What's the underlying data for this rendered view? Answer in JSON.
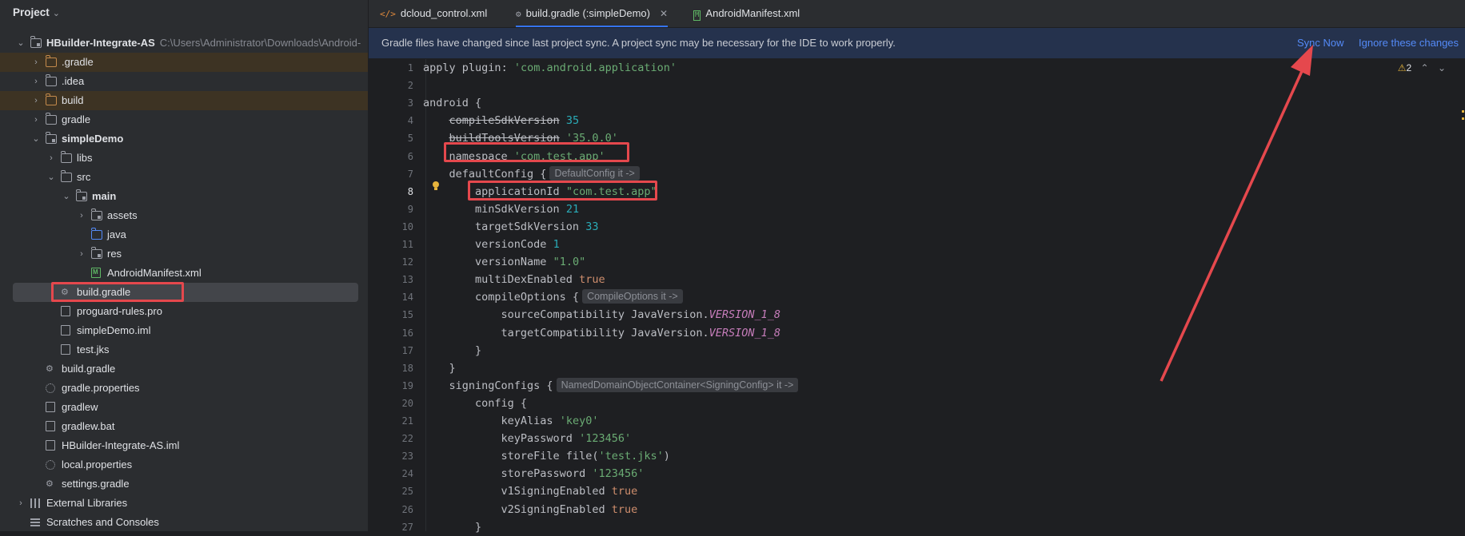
{
  "project": {
    "title": "Project",
    "tree": [
      {
        "label": "HBuilder-Integrate-AS",
        "path": "C:\\Users\\Administrator\\Downloads\\Android-",
        "depth": 0,
        "icon": "module-folder-icon",
        "expand": "down",
        "bold": true
      },
      {
        "label": ".gradle",
        "depth": 1,
        "icon": "folder-orange-icon",
        "expand": "right",
        "hl": true
      },
      {
        "label": ".idea",
        "depth": 1,
        "icon": "folder-icon",
        "expand": "right"
      },
      {
        "label": "build",
        "depth": 1,
        "icon": "folder-orange-icon",
        "expand": "right",
        "hl": true
      },
      {
        "label": "gradle",
        "depth": 1,
        "icon": "folder-icon",
        "expand": "right"
      },
      {
        "label": "simpleDemo",
        "depth": 1,
        "icon": "module-folder-icon",
        "expand": "down",
        "bold": true
      },
      {
        "label": "libs",
        "depth": 2,
        "icon": "folder-icon",
        "expand": "right"
      },
      {
        "label": "src",
        "depth": 2,
        "icon": "folder-icon",
        "expand": "down"
      },
      {
        "label": "main",
        "depth": 3,
        "icon": "module-folder-icon",
        "expand": "down",
        "bold": true
      },
      {
        "label": "assets",
        "depth": 4,
        "icon": "module-folder-icon",
        "expand": "right"
      },
      {
        "label": "java",
        "depth": 4,
        "icon": "folder-blue-icon",
        "expand": ""
      },
      {
        "label": "res",
        "depth": 4,
        "icon": "module-folder-icon",
        "expand": "right"
      },
      {
        "label": "AndroidManifest.xml",
        "depth": 4,
        "icon": "manifest-file-icon",
        "expand": ""
      },
      {
        "label": "build.gradle",
        "depth": 2,
        "icon": "gradle-icon",
        "expand": "",
        "selected": true
      },
      {
        "label": "proguard-rules.pro",
        "depth": 2,
        "icon": "file-icon",
        "expand": ""
      },
      {
        "label": "simpleDemo.iml",
        "depth": 2,
        "icon": "file-icon",
        "expand": ""
      },
      {
        "label": "test.jks",
        "depth": 2,
        "icon": "file-icon",
        "expand": ""
      },
      {
        "label": "build.gradle",
        "depth": 1,
        "icon": "gradle-icon",
        "expand": ""
      },
      {
        "label": "gradle.properties",
        "depth": 1,
        "icon": "gear-icon",
        "expand": ""
      },
      {
        "label": "gradlew",
        "depth": 1,
        "icon": "file-icon",
        "expand": ""
      },
      {
        "label": "gradlew.bat",
        "depth": 1,
        "icon": "file-icon",
        "expand": ""
      },
      {
        "label": "HBuilder-Integrate-AS.iml",
        "depth": 1,
        "icon": "file-icon",
        "expand": ""
      },
      {
        "label": "local.properties",
        "depth": 1,
        "icon": "gear-icon",
        "expand": ""
      },
      {
        "label": "settings.gradle",
        "depth": 1,
        "icon": "gradle-icon",
        "expand": ""
      },
      {
        "label": "External Libraries",
        "depth": 0,
        "icon": "library-icon",
        "expand": "right"
      },
      {
        "label": "Scratches and Consoles",
        "depth": 0,
        "icon": "scratch-icon",
        "expand": ""
      }
    ]
  },
  "tabs": [
    {
      "label": "dcloud_control.xml",
      "icon": "</>",
      "kind": "xml",
      "active": false
    },
    {
      "label": "build.gradle (:simpleDemo)",
      "icon": "⚙",
      "kind": "grd",
      "active": true,
      "close": "✕"
    },
    {
      "label": "AndroidManifest.xml",
      "icon": "M",
      "kind": "man",
      "active": false
    }
  ],
  "banner": {
    "message": "Gradle files have changed since last project sync. A project sync may be necessary for the IDE to work properly.",
    "sync_now": "Sync Now",
    "ignore": "Ignore these changes"
  },
  "editor": {
    "current_line": 8,
    "warnings": "2",
    "lines": [
      [
        [
          "apply ",
          ""
        ],
        [
          "plugin",
          ""
        ],
        [
          ": ",
          ""
        ],
        [
          "'com.android.application'",
          "str"
        ]
      ],
      [],
      [
        [
          "android {",
          ""
        ]
      ],
      [
        [
          "    ",
          ""
        ],
        [
          "compileSdkVersion",
          "strike"
        ],
        [
          " ",
          ""
        ],
        [
          "35",
          "num"
        ]
      ],
      [
        [
          "    ",
          ""
        ],
        [
          "buildToolsVersion",
          "strike"
        ],
        [
          " ",
          ""
        ],
        [
          "'35.0.0'",
          "str"
        ]
      ],
      [
        [
          "    namespace ",
          ""
        ],
        [
          "'com.test.app'",
          "str"
        ]
      ],
      [
        [
          "    defaultConfig {",
          ""
        ],
        [
          "DefaultConfig it ->",
          "hint"
        ]
      ],
      [
        [
          "        applicationId ",
          ""
        ],
        [
          "\"com.test.app\"",
          "str"
        ]
      ],
      [
        [
          "        minSdkVersion ",
          ""
        ],
        [
          "21",
          "num"
        ]
      ],
      [
        [
          "        targetSdkVersion ",
          ""
        ],
        [
          "33",
          "num"
        ]
      ],
      [
        [
          "        versionCode ",
          ""
        ],
        [
          "1",
          "num"
        ]
      ],
      [
        [
          "        versionName ",
          ""
        ],
        [
          "\"1.0\"",
          "str"
        ]
      ],
      [
        [
          "        multiDexEnabled ",
          ""
        ],
        [
          "true",
          "bool"
        ]
      ],
      [
        [
          "        compileOptions {",
          ""
        ],
        [
          "CompileOptions it ->",
          "hint"
        ]
      ],
      [
        [
          "            sourceCompatibility JavaVersion.",
          ""
        ],
        [
          "VERSION_1_8",
          "const"
        ]
      ],
      [
        [
          "            targetCompatibility JavaVersion.",
          ""
        ],
        [
          "VERSION_1_8",
          "const"
        ]
      ],
      [
        [
          "        }",
          ""
        ]
      ],
      [
        [
          "    }",
          ""
        ]
      ],
      [
        [
          "    signingConfigs {",
          ""
        ],
        [
          "NamedDomainObjectContainer<SigningConfig> it ->",
          "hint"
        ]
      ],
      [
        [
          "        config {",
          ""
        ]
      ],
      [
        [
          "            keyAlias ",
          ""
        ],
        [
          "'key0'",
          "str"
        ]
      ],
      [
        [
          "            keyPassword ",
          ""
        ],
        [
          "'123456'",
          "str"
        ]
      ],
      [
        [
          "            storeFile file(",
          ""
        ],
        [
          "'test.jks'",
          "str"
        ],
        [
          ")",
          ""
        ]
      ],
      [
        [
          "            storePassword ",
          ""
        ],
        [
          "'123456'",
          "str"
        ]
      ],
      [
        [
          "            v1SigningEnabled ",
          ""
        ],
        [
          "true",
          "bool"
        ]
      ],
      [
        [
          "            v2SigningEnabled ",
          ""
        ],
        [
          "true",
          "bool"
        ]
      ],
      [
        [
          "        }",
          ""
        ]
      ]
    ]
  },
  "colors": {
    "accent": "#3574f0",
    "annotation": "#e5484d",
    "link": "#548af7"
  }
}
